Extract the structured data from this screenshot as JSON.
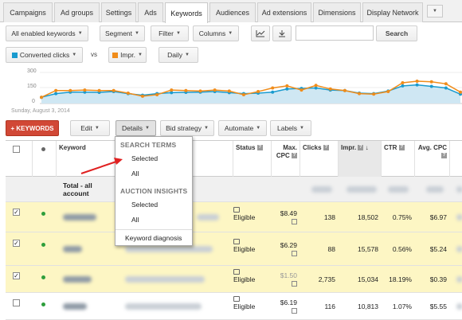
{
  "tabs": [
    "Campaigns",
    "Ad groups",
    "Settings",
    "Ads",
    "Keywords",
    "Audiences",
    "Ad extensions",
    "Dimensions",
    "Display Network"
  ],
  "active_tab": "Keywords",
  "filter_bar": {
    "scope": "All enabled keywords",
    "segment": "Segment",
    "filter": "Filter",
    "columns": "Columns",
    "search_button": "Search",
    "search_value": ""
  },
  "chart_controls": {
    "metric1": "Converted clicks",
    "vs": "vs",
    "metric2": "Impr.",
    "period": "Daily",
    "metric1_color": "#1a9bcf",
    "metric2_color": "#f08c1a"
  },
  "chart": {
    "y_ticks": [
      "300",
      "150",
      "0"
    ],
    "date_label": "Sunday, August 3, 2014",
    "series_blue": [
      60,
      95,
      110,
      110,
      108,
      115,
      95,
      80,
      95,
      105,
      108,
      110,
      115,
      105,
      95,
      100,
      110,
      140,
      145,
      150,
      130,
      125,
      100,
      95,
      120,
      170,
      180,
      165,
      150,
      90
    ],
    "series_orange": [
      60,
      125,
      125,
      130,
      125,
      125,
      100,
      70,
      85,
      130,
      125,
      120,
      130,
      120,
      85,
      115,
      150,
      170,
      130,
      175,
      140,
      125,
      95,
      90,
      115,
      200,
      215,
      210,
      190,
      110
    ]
  },
  "toolbar": {
    "add_label": "+ KEYWORDS",
    "edit": "Edit",
    "details": "Details",
    "bid_strategy": "Bid strategy",
    "automate": "Automate",
    "labels": "Labels"
  },
  "table": {
    "headers": {
      "keyword": "Keyword",
      "status": "Status",
      "max_cpc": "Max. CPC",
      "clicks": "Clicks",
      "impr": "Impr.",
      "ctr": "CTR",
      "avg_cpc": "Avg. CPC"
    },
    "total_label": "Total - all account",
    "rows": [
      {
        "checked": true,
        "status": "Eligible",
        "max_cpc": "$8.49",
        "clicks": "138",
        "impr": "18,502",
        "ctr": "0.75%",
        "avg_cpc": "$6.97",
        "selected": true
      },
      {
        "checked": true,
        "status": "Eligible",
        "max_cpc": "$6.29",
        "clicks": "88",
        "impr": "15,578",
        "ctr": "0.56%",
        "avg_cpc": "$5.24",
        "selected": true
      },
      {
        "checked": true,
        "status": "Eligible",
        "max_cpc": "$1.50",
        "clicks": "2,735",
        "impr": "15,034",
        "ctr": "18.19%",
        "avg_cpc": "$0.39",
        "selected": true
      },
      {
        "checked": false,
        "status": "Eligible",
        "max_cpc": "$6.19",
        "clicks": "116",
        "impr": "10,813",
        "ctr": "1.07%",
        "avg_cpc": "$5.55",
        "selected": false
      }
    ]
  },
  "details_menu": {
    "search_terms_header": "SEARCH TERMS",
    "st_selected": "Selected",
    "st_all": "All",
    "auction_header": "AUCTION INSIGHTS",
    "ai_selected": "Selected",
    "ai_all": "All",
    "diagnosis": "Keyword diagnosis"
  },
  "annotation_color": "#e02020"
}
